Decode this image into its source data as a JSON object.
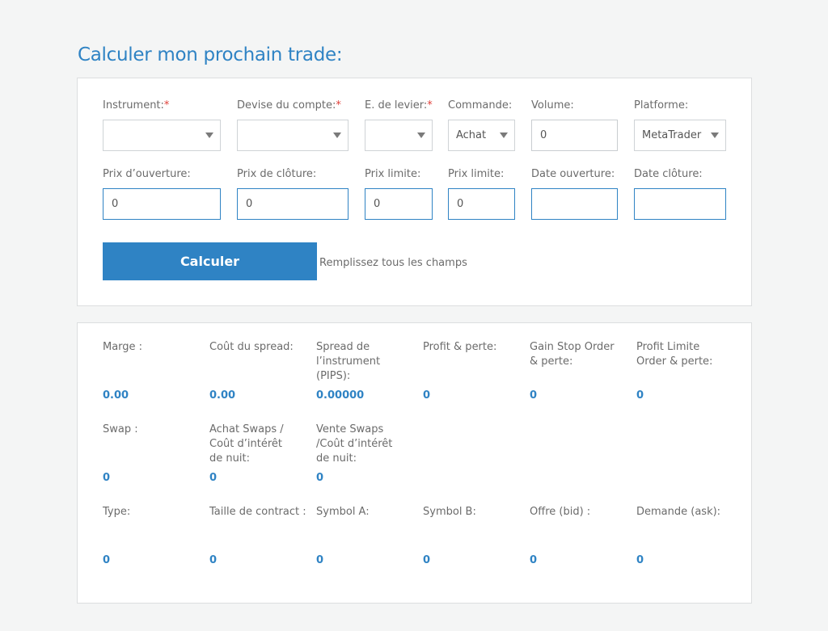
{
  "title": "Calculer mon prochain trade:",
  "form": {
    "required_mark": "*",
    "instrument_label": "Instrument:",
    "currency_label": "Devise du compte:",
    "leverage_label": "E. de levier:",
    "command_label": "Commande:",
    "command_value": "Achat",
    "volume_label": "Volume:",
    "volume_value": "0",
    "platform_label": "Platforme:",
    "platform_value": "MetaTrader",
    "open_price_label": "Prix d’ouverture:",
    "open_price_value": "0",
    "close_price_label": "Prix de clôture:",
    "close_price_value": "0",
    "limit_price1_label": "Prix limite:",
    "limit_price1_value": "0",
    "limit_price2_label": "Prix limite:",
    "limit_price2_value": "0",
    "open_date_label": "Date ouverture:",
    "close_date_label": "Date clôture:",
    "calculate_button": "Calculer",
    "hint": "Remplissez tous les champs"
  },
  "results": {
    "row1": [
      {
        "label": "Marge :",
        "value": "0.00"
      },
      {
        "label": "Coût du spread:",
        "value": "0.00"
      },
      {
        "label": "Spread de l’instrument (PIPS):",
        "value": "0.00000"
      },
      {
        "label": "Profit & perte:",
        "value": "0"
      },
      {
        "label": "Gain Stop Order & perte:",
        "value": "0"
      },
      {
        "label": "Profit Limite Order & perte:",
        "value": "0"
      }
    ],
    "row2": [
      {
        "label": "Swap :",
        "value": "0"
      },
      {
        "label": "Achat Swaps / Coût d’intérêt de nuit:",
        "value": "0"
      },
      {
        "label": "Vente Swaps /Coût d’intérêt de nuit:",
        "value": "0"
      }
    ],
    "row3": [
      {
        "label": "Type:",
        "value": "0"
      },
      {
        "label": "Taille de contract :",
        "value": "0"
      },
      {
        "label": "Symbol A:",
        "value": "0"
      },
      {
        "label": "Symbol B:",
        "value": "0"
      },
      {
        "label": "Offre (bid) :",
        "value": "0"
      },
      {
        "label": "Demande (ask):",
        "value": "0"
      }
    ]
  },
  "icons": {
    "select_caret": "caret-down-icon"
  },
  "colors": {
    "accent": "#2f83c4",
    "required": "#e0403a",
    "background": "#f4f5f5"
  }
}
